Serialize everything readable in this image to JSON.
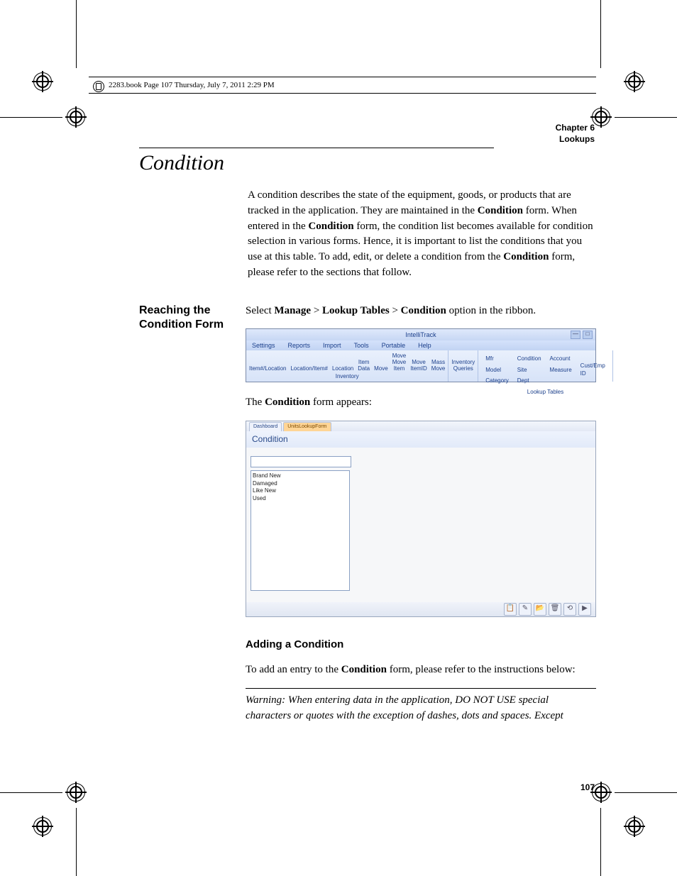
{
  "file_tag": "2283.book  Page 107  Thursday, July 7, 2011  2:29 PM",
  "running_header": {
    "line1": "Chapter 6",
    "line2": "Lookups"
  },
  "section_title": "Condition",
  "intro_paragraph_parts": {
    "p1a": "A condition describes the state of the equipment, goods, or products that are tracked in the application. They are maintained in the ",
    "b1": "Condition",
    "p1b": " form. When entered in the ",
    "b2": "Condition",
    "p1c": " form, the condition list becomes available for condition selection in various forms. Hence, it is important to list the conditions that you use at this table. To add, edit, or delete a condition from the ",
    "b3": "Condition",
    "p1d": " form, please refer to the sections that follow."
  },
  "side_heading": "Reaching the Condition Form",
  "reach": {
    "pre": "Select ",
    "b1": "Manage",
    "sep1": " > ",
    "b2": "Lookup Tables",
    "sep2": " > ",
    "b3": "Condition",
    "post": " option in the ribbon."
  },
  "appears": {
    "pre": "The ",
    "b": "Condition",
    "post": " form appears:"
  },
  "subheading": "Adding a Condition",
  "adding": {
    "pre": "To add an entry to the ",
    "b": "Condition",
    "post": " form, please refer to the instructions below:"
  },
  "warning": "Warning:   When entering data in the application, DO NOT USE special characters or quotes with the exception of dashes, dots and spaces. Except",
  "page_number": "107",
  "ribbon_shot": {
    "app_title": "IntelliTrack",
    "menu": [
      "Settings",
      "Reports",
      "Import",
      "Tools",
      "Portable",
      "Help"
    ],
    "inventory_group": {
      "buttons": [
        "Item#/Location",
        "Location/Item#",
        "Location",
        "Item Data",
        "Move",
        "Move Move Item",
        "Move ItemID",
        "Mass Move"
      ],
      "caption": "Inventory"
    },
    "queries_group": {
      "label": "Inventory Queries"
    },
    "lookup_group": {
      "col1": [
        "Mfr",
        "Model",
        "Category"
      ],
      "col2": [
        "Condition",
        "Site",
        "Dept"
      ],
      "col3": [
        "Account",
        "Measure"
      ],
      "col4": [
        "Cust/Emp ID"
      ],
      "caption": "Lookup Tables"
    }
  },
  "form_shot": {
    "tabs": [
      "Dashboard",
      "UnitsLookupForm"
    ],
    "active_tab_index": 1,
    "title": "Condition",
    "list_items": [
      "Brand New",
      "Damaged",
      "Like New",
      "Used"
    ],
    "toolbar_icons": [
      "📋",
      "✎",
      "📂",
      "🗑",
      "⟲",
      "▶"
    ]
  }
}
